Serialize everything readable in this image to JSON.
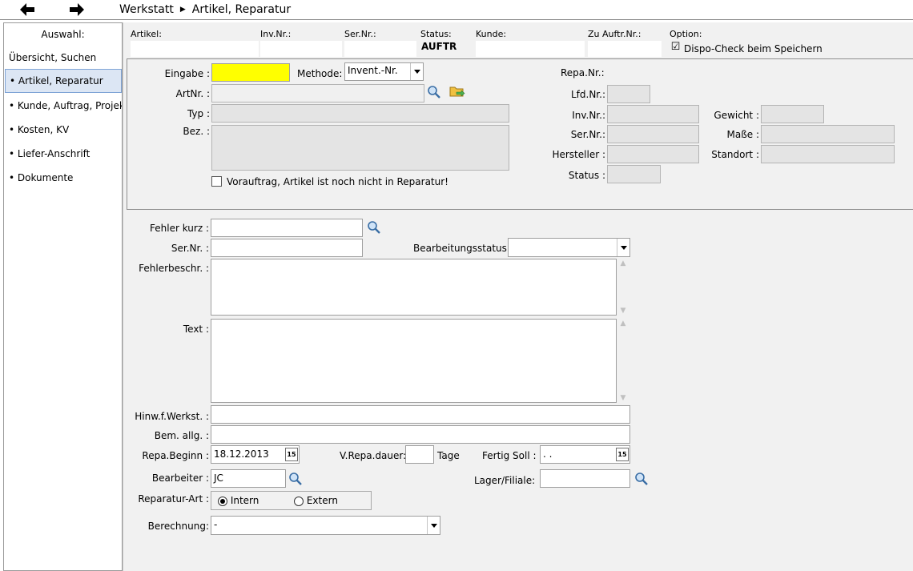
{
  "topbar": {
    "breadcrumb": [
      "Werkstatt",
      "Artikel, Reparatur"
    ],
    "back_icon": "arrow-left-icon",
    "forward_icon": "arrow-right-icon"
  },
  "sidebar": {
    "heading": "Auswahl:",
    "items": [
      {
        "label": "Übersicht, Suchen",
        "selected": false
      },
      {
        "label": "• Artikel, Reparatur",
        "selected": true
      },
      {
        "label": "• Kunde, Auftrag, Projekt",
        "selected": false
      },
      {
        "label": "• Kosten, KV",
        "selected": false
      },
      {
        "label": "• Liefer-Anschrift",
        "selected": false
      },
      {
        "label": "• Dokumente",
        "selected": false
      }
    ]
  },
  "header": {
    "artikel_label": "Artikel:",
    "invnr_label": "Inv.Nr.:",
    "sernr_label": "Ser.Nr.:",
    "status_label": "Status:",
    "status_value": "AUFTR",
    "kunde_label": "Kunde:",
    "zuauftr_label": "Zu Auftr.Nr.:",
    "option_label": "Option:",
    "dispo_label": "Dispo-Check beim Speichern",
    "dispo_checked": "☑"
  },
  "article": {
    "eingabe_label": "Eingabe :",
    "methode_label": "Methode:",
    "methode_value": "Invent.-Nr.",
    "artnr_label": "ArtNr. :",
    "typ_label": "Typ :",
    "bez_label": "Bez. :",
    "vorauftrag_label": "Vorauftrag, Artikel ist noch nicht in Reparatur!",
    "repanr_label": "Repa.Nr.:",
    "lfdnr_label": "Lfd.Nr.:",
    "invnr_label": "Inv.Nr.:",
    "sernr_label": "Ser.Nr.:",
    "hersteller_label": "Hersteller :",
    "status_label": "Status :",
    "gewicht_label": "Gewicht :",
    "masse_label": "Maße :",
    "standort_label": "Standort :",
    "accent_yellow": "#ffff00"
  },
  "repair": {
    "fehler_kurz_label": "Fehler kurz :",
    "sernr_label": "Ser.Nr. :",
    "bearbeitungsstatus_label": "Bearbeitungsstatus:",
    "fehlerbeschr_label": "Fehlerbeschr. :",
    "text_label": "Text :",
    "hinw_label": "Hinw.f.Werkst. :",
    "bem_label": "Bem. allg. :",
    "repa_beginn_label": "Repa.Beginn :",
    "repa_beginn_value": "18.12.2013",
    "vrepa_label": "V.Repa.dauer:",
    "tage_label": "Tage",
    "fertig_label": "Fertig Soll :",
    "fertig_value": " .  .",
    "bearbeiter_label": "Bearbeiter :",
    "bearbeiter_value": "JC",
    "lager_label": "Lager/Filiale:",
    "art_label": "Reparatur-Art :",
    "intern_label": "Intern",
    "extern_label": "Extern",
    "berechnung_label": "Berechnung:",
    "berechnung_value": "-",
    "calendar_day": "15"
  }
}
